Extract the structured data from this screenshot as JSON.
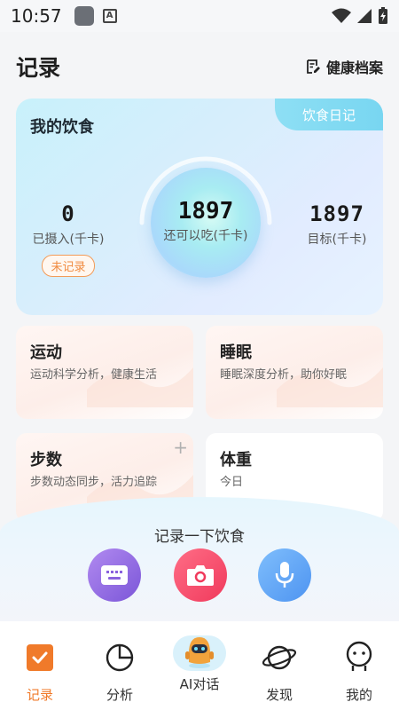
{
  "status_bar": {
    "time": "10:57",
    "a_icon": "A"
  },
  "header": {
    "title": "记录",
    "health_link": "健康档案"
  },
  "diet": {
    "title": "我的饮食",
    "diary_tab": "饮食日记",
    "intake_value": "0",
    "intake_label": "已摄入(千卡)",
    "not_recorded": "未记录",
    "remaining_value": "1897",
    "remaining_label": "还可以吃(千卡)",
    "target_value": "1897",
    "target_label": "目标(千卡)"
  },
  "cards": {
    "exercise": {
      "title": "运动",
      "subtitle": "运动科学分析，健康生活"
    },
    "sleep": {
      "title": "睡眠",
      "subtitle": "睡眠深度分析，助你好眠"
    },
    "steps": {
      "title": "步数",
      "subtitle": "步数动态同步，活力追踪",
      "plus": "+"
    },
    "weight": {
      "title": "体重",
      "subtitle": "今日"
    }
  },
  "record": {
    "title": "记录一下饮食"
  },
  "nav": {
    "items": [
      {
        "label": "记录",
        "icon": "record-check-icon",
        "active": true
      },
      {
        "label": "分析",
        "icon": "pie-chart-icon",
        "active": false
      },
      {
        "label": "AI对话",
        "icon": "robot-icon",
        "active": false
      },
      {
        "label": "发现",
        "icon": "planet-icon",
        "active": false
      },
      {
        "label": "我的",
        "icon": "profile-icon",
        "active": false
      }
    ]
  },
  "colors": {
    "accent": "#f07a2a",
    "diet_tab": "#8edff4",
    "camera": "#f03a5c",
    "keyboard": "#7b56d8",
    "mic": "#4e94f1"
  }
}
